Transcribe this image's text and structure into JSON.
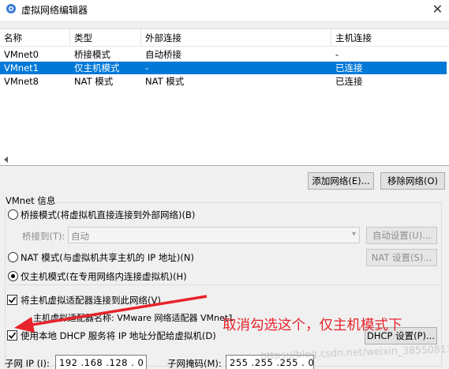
{
  "window": {
    "title": "虚拟网络编辑器",
    "close_glyph": "✕"
  },
  "network_list": {
    "columns": [
      "名称",
      "类型",
      "外部连接",
      "主机连接"
    ],
    "rows": [
      {
        "name": "VMnet0",
        "type": "桥接模式",
        "external": "自动桥接",
        "host": "-",
        "selected": false
      },
      {
        "name": "VMnet1",
        "type": "仅主机模式",
        "external": "-",
        "host": "已连接",
        "selected": true
      },
      {
        "name": "VMnet8",
        "type": "NAT 模式",
        "external": "NAT 模式",
        "host": "已连接",
        "selected": false
      }
    ]
  },
  "actions": {
    "add_network": "添加网络(E)...",
    "remove_network": "移除网络(O)"
  },
  "vmnet_info": {
    "group_title": "VMnet 信息",
    "bridged_label": "桥接模式(将虚拟机直接连接到外部网络)(B)",
    "bridged_to_label": "桥接到(T):",
    "bridged_to_value": "自动",
    "auto_settings": "自动设置(U)...",
    "nat_label": "NAT 模式(与虚拟机共享主机的 IP 地址)(N)",
    "nat_settings": "NAT 设置(S)...",
    "host_only_label": "仅主机模式(在专用网络内连接虚拟机)(H)",
    "selected_mode": "host_only",
    "connect_adapter_label": "将主机虚拟适配器连接到此网络(V)",
    "connect_adapter_checked": true,
    "adapter_name_label": "主机虚拟适配器名称: VMware 网络适配器 VMnet1",
    "dhcp_label": "使用本地 DHCP 服务将 IP 地址分配给虚拟机(D)",
    "dhcp_checked": true,
    "dhcp_settings": "DHCP 设置(P)...",
    "subnet_ip_label": "子网 IP (I):",
    "subnet_ip_value": "192 .168 .128 . 0",
    "subnet_mask_label": "子网掩码(M):",
    "subnet_mask_value": "255 .255 .255 . 0"
  },
  "annotation": {
    "text": "取消勾选这个，仅主机模式下",
    "color": "#e8232b"
  },
  "watermark": "https://blog.csdn.net/weixin_38550813",
  "colors": {
    "selection": "#0078d7",
    "annotation_red": "#e8232b"
  }
}
